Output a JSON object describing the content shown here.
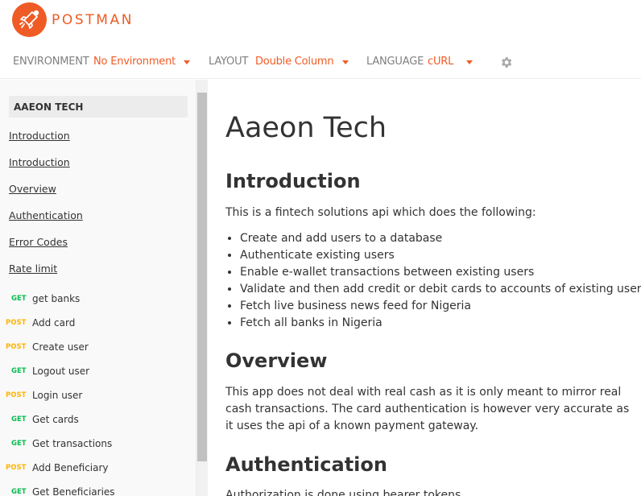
{
  "brand": {
    "name": "POSTMAN",
    "color": "#ef5b25"
  },
  "toolbar": {
    "environment_label": "ENVIRONMENT",
    "environment_value": "No Environment",
    "layout_label": "LAYOUT",
    "layout_value": "Double Column",
    "language_label": "LANGUAGE",
    "language_value": "cURL",
    "settings_icon": "gear-icon"
  },
  "sidebar": {
    "collection": "AAEON TECH",
    "links": [
      "Introduction",
      "Introduction",
      "Overview",
      "Authentication",
      "Error Codes",
      "Rate limit"
    ],
    "requests": [
      {
        "method": "GET",
        "name": "get banks"
      },
      {
        "method": "POST",
        "name": "Add card"
      },
      {
        "method": "POST",
        "name": "Create user"
      },
      {
        "method": "GET",
        "name": "Logout user"
      },
      {
        "method": "POST",
        "name": "Login user"
      },
      {
        "method": "GET",
        "name": "Get cards"
      },
      {
        "method": "GET",
        "name": "Get transactions"
      },
      {
        "method": "POST",
        "name": "Add Beneficiary"
      },
      {
        "method": "GET",
        "name": "Get Beneficiaries"
      }
    ]
  },
  "main": {
    "title": "Aaeon Tech",
    "introduction": {
      "heading": "Introduction",
      "text": "This is a fintech solutions api which does the following:",
      "bullets": [
        "Create and add users to a database",
        "Authenticate existing users",
        "Enable e-wallet transactions between existing users",
        "Validate and then add credit or debit cards to accounts of existing users",
        "Fetch live business news feed for Nigeria",
        "Fetch all banks in Nigeria"
      ]
    },
    "overview": {
      "heading": "Overview",
      "text": "This app does not deal with real cash as it is only meant to mirror real cash transactions. The card authentication is however very accurate as it uses the api of a known payment gateway."
    },
    "authentication": {
      "heading": "Authentication",
      "text": "Authorization is done using bearer tokens"
    }
  },
  "colors": {
    "get": "#0cbb52",
    "post": "#ffb400",
    "accent": "#ef5b25"
  }
}
